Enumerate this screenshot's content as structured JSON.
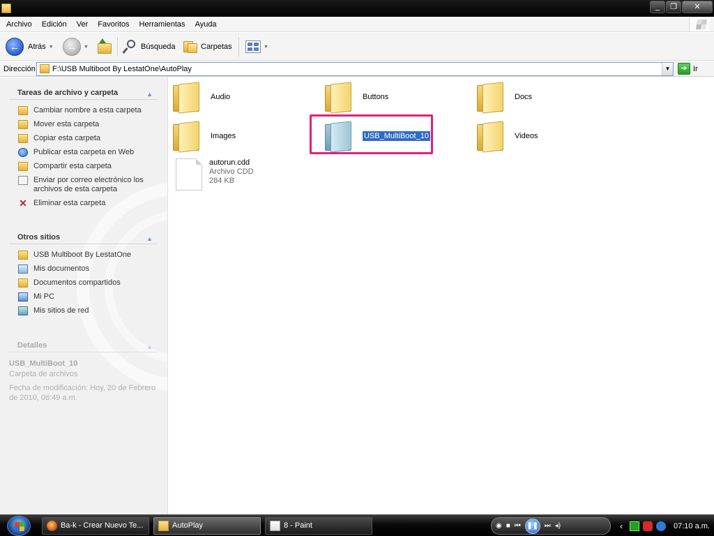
{
  "menu": [
    "Archivo",
    "Edición",
    "Ver",
    "Favoritos",
    "Herramientas",
    "Ayuda"
  ],
  "toolbar": {
    "back_label": "Atrás",
    "search_label": "Búsqueda",
    "folders_label": "Carpetas"
  },
  "address": {
    "label": "Dirección",
    "path": "F:\\USB Multiboot By LestatOne\\AutoPlay",
    "go_label": "Ir"
  },
  "left": {
    "tasks_title": "Tareas de archivo y carpeta",
    "tasks": [
      "Cambiar nombre a esta carpeta",
      "Mover esta carpeta",
      "Copiar esta carpeta",
      "Publicar esta carpeta en Web",
      "Compartir esta carpeta",
      "Enviar por correo electrónico los archivos de esta carpeta",
      "Eliminar esta carpeta"
    ],
    "places_title": "Otros sitios",
    "places": [
      "USB Multiboot By LestatOne",
      "Mis documentos",
      "Documentos compartidos",
      "Mi PC",
      "Mis sitios de red"
    ],
    "details_title": "Detalles",
    "details_name": "USB_MultiBoot_10",
    "details_type": "Carpeta de archivos",
    "details_modified": "Fecha de modificación: Hoy, 20 de Febrero de 2010, 06:49 a.m."
  },
  "content": {
    "folders": [
      "Audio",
      "Buttons",
      "Docs",
      "Images",
      "USB_MultiBoot_10",
      "Videos"
    ],
    "file": {
      "name": "autorun.cdd",
      "type": "Archivo CDD",
      "size": "284 KB"
    }
  },
  "taskbar": {
    "tasks": [
      "Ba-k - Crear Nuevo Te...",
      "AutoPlay",
      "8 - Paint"
    ],
    "clock": "07:10 a.m."
  }
}
